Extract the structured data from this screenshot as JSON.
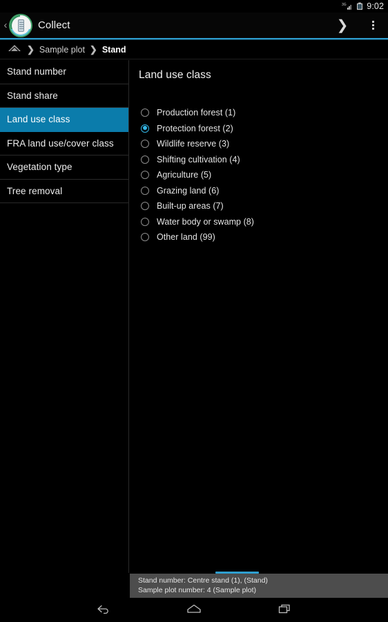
{
  "status_bar": {
    "signal_icon": "signal-3g-icon",
    "signal_label": "3G",
    "battery_icon": "battery-icon",
    "time": "9:02"
  },
  "action_bar": {
    "up_caret": "‹",
    "logo_icon": "collect-app-logo-icon",
    "title": "Collect",
    "next_icon": "❯",
    "overflow_icon": "overflow-menu-icon"
  },
  "breadcrumb": {
    "home_icon": "home-icon",
    "separator": "❯",
    "items": [
      {
        "label": "Sample plot",
        "current": false
      },
      {
        "label": "Stand",
        "current": true
      }
    ]
  },
  "sidebar": {
    "items": [
      {
        "label": "Stand number",
        "active": false
      },
      {
        "label": "Stand share",
        "active": false
      },
      {
        "label": "Land use class",
        "active": true
      },
      {
        "label": "FRA land use/cover class",
        "active": false
      },
      {
        "label": "Vegetation type",
        "active": false
      },
      {
        "label": "Tree removal",
        "active": false
      }
    ]
  },
  "content": {
    "title": "Land use class",
    "options": [
      {
        "label": "Production forest (1)",
        "checked": false
      },
      {
        "label": "Protection forest (2)",
        "checked": true
      },
      {
        "label": "Wildlife reserve (3)",
        "checked": false
      },
      {
        "label": "Shifting cultivation (4)",
        "checked": false
      },
      {
        "label": "Agriculture (5)",
        "checked": false
      },
      {
        "label": "Grazing land (6)",
        "checked": false
      },
      {
        "label": "Built-up areas (7)",
        "checked": false
      },
      {
        "label": "Water body or swamp (8)",
        "checked": false
      },
      {
        "label": "Other land (99)",
        "checked": false
      }
    ]
  },
  "info_panel": {
    "line1": "Stand number: Centre stand (1),  (Stand)",
    "line2": "Sample plot number: 4 (Sample plot)"
  },
  "nav_bar": {
    "back_icon": "back-icon",
    "home_icon": "home-icon",
    "recents_icon": "recents-icon"
  },
  "colors": {
    "accent_blue": "#0b7cab",
    "holo_blue": "#33b5e5",
    "divider_blue": "#2f9fd0",
    "panel_gray": "#4d4d4d",
    "background": "#000000"
  }
}
